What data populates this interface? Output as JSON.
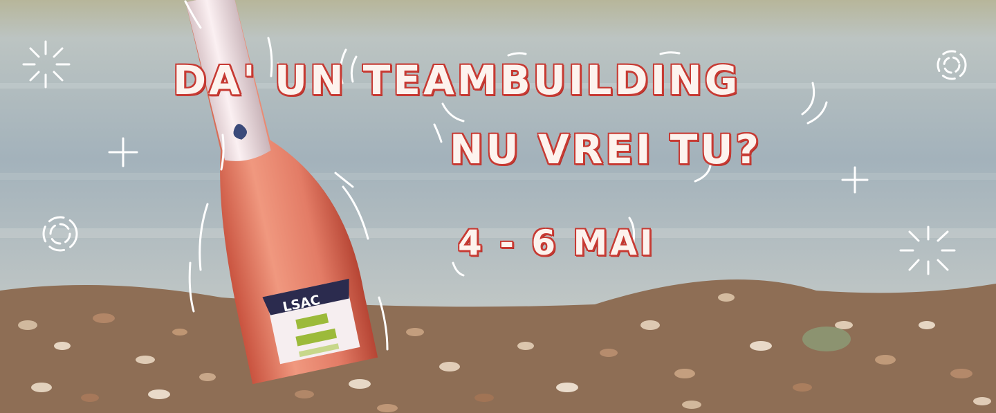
{
  "headline": {
    "line1": "DA' UN TEAMBUILDING",
    "line2": "NU VREI TU?",
    "dates": "4 - 6 MAI"
  },
  "bottle": {
    "label_text": "LSAC"
  },
  "colors": {
    "headline_outline": "#c73a33",
    "headline_fill": "#fdf3ee",
    "wine": "#e4806c",
    "foil": "#f2e2e6",
    "label_dark": "#2b2b4e",
    "label_green": "#9cba3a",
    "decoration": "#ffffff"
  },
  "icons": [
    "sparkle-icon",
    "plus-icon",
    "dashed-circle-icon"
  ]
}
